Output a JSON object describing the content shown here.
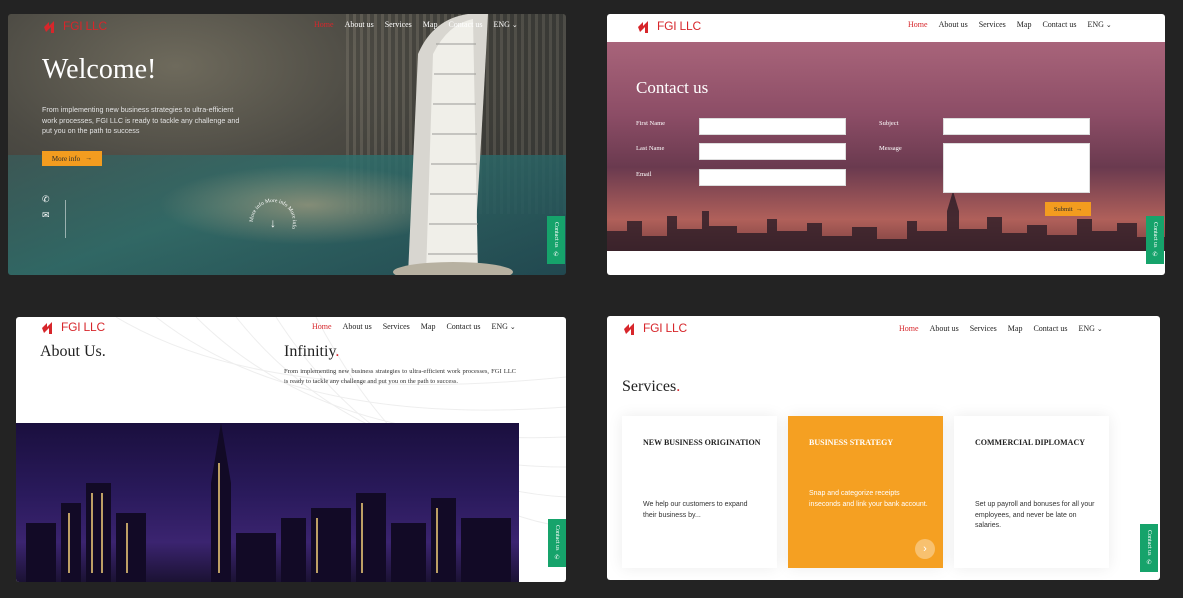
{
  "brand": {
    "name": "FGI LLC",
    "color": "#d7262b"
  },
  "nav": {
    "home": "Home",
    "about": "About us",
    "services": "Services",
    "map": "Map",
    "contact": "Contact us",
    "lang": "ENG"
  },
  "contact_tab": {
    "label": "Contact us",
    "icon": "whatsapp-icon"
  },
  "welcome_page": {
    "title": "Welcome!",
    "intro": "From implementing new business strategies to ultra-efficient work processes, FGI LLC is ready to tackle any challenge and put you on the path to success",
    "more_button": "More info",
    "scroll_circle": "More info More info More info",
    "social": [
      "whatsapp-icon",
      "mail-icon"
    ]
  },
  "contact_page": {
    "title": "Contact us",
    "first_name_label": "First Name",
    "last_name_label": "Last Name",
    "email_label": "Email",
    "subject_label": "Subject",
    "message_label": "Message",
    "submit_label": "Submit"
  },
  "about_page": {
    "title": "About Us",
    "sub_title": "Infinitiy",
    "dot": ".",
    "body": "From implementing new business strategies to ultra-efficient work processes, FGI LLC is ready to tackle any challenge and put you on the path to success."
  },
  "services_page": {
    "title": "Services",
    "dot": ".",
    "cards": [
      {
        "title": "NEW BUSINESS ORIGINATION",
        "body": "We help our customers to expand their business by..."
      },
      {
        "title": "BUSINESS STRATEGY",
        "body": "Snap and categorize receipts inseconds and link your bank account."
      },
      {
        "title": "COMMERCIAL DIPLOMACY",
        "body": "Set up payroll and bonuses for all your employees, and never be late on salaries."
      }
    ]
  },
  "colors": {
    "accent": "#f39c1f",
    "green": "#16a36b",
    "red": "#d7262b"
  }
}
